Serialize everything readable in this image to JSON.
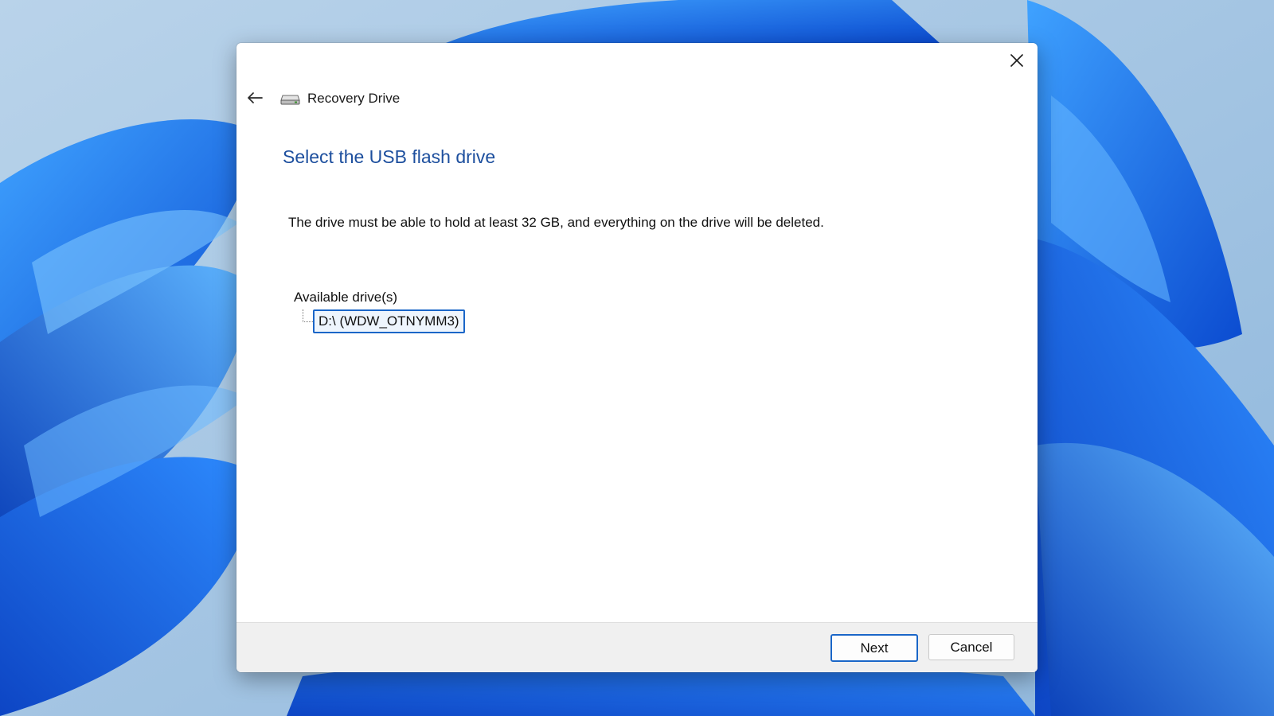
{
  "wizard": {
    "app_title": "Recovery Drive",
    "heading": "Select the USB flash drive",
    "description": "The drive must be able to hold at least 32 GB, and everything on the drive will be deleted.",
    "drives_label": "Available drive(s)",
    "drives": [
      {
        "label": "D:\\ (WDW_OTNYMM3)",
        "selected": true
      }
    ],
    "buttons": {
      "next": "Next",
      "cancel": "Cancel"
    }
  },
  "icons": {
    "close": "close-icon",
    "back": "back-arrow-icon",
    "app": "drive-icon"
  },
  "colors": {
    "heading": "#1d4f9e",
    "accent": "#1a66c8",
    "footer": "#f0f0f0",
    "wallpaper": "#1560d8"
  }
}
